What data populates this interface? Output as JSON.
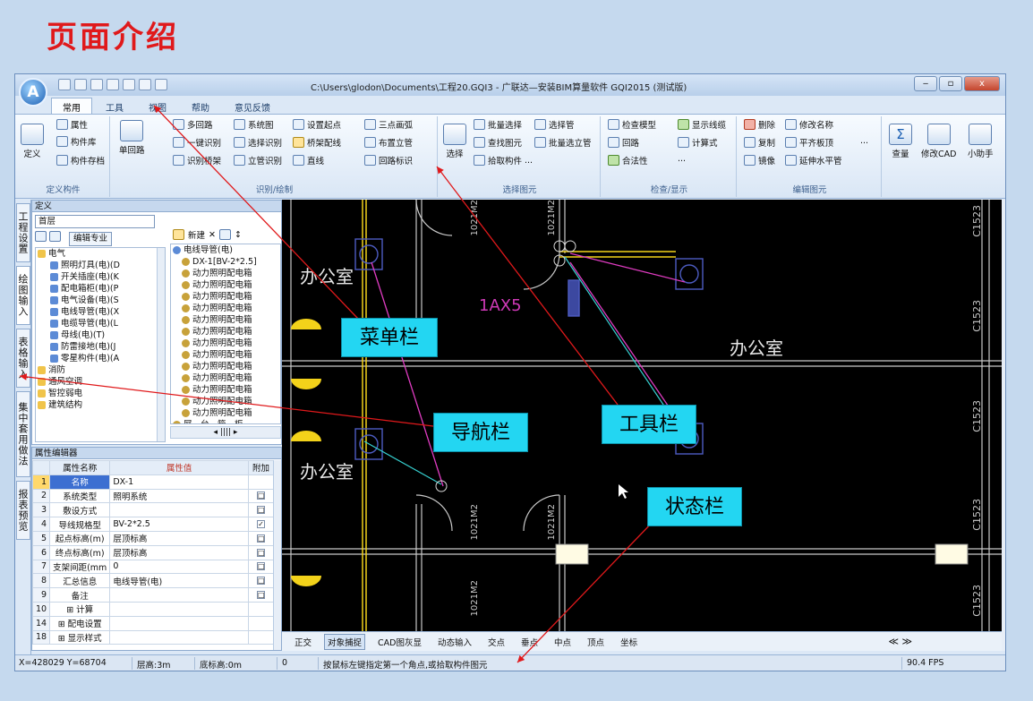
{
  "page_title": "页面介绍",
  "app": {
    "logo": "A",
    "window_title": "C:\\Users\\glodon\\Documents\\工程20.GQI3 - 广联达—安装BIM算量软件 GQI2015 (测试版)",
    "tabs": [
      "常用",
      "工具",
      "视图",
      "帮助",
      "意见反馈"
    ],
    "window_buttons": {
      "minimize": "‒",
      "restore": "▫",
      "close": "x"
    }
  },
  "ribbon": {
    "define": {
      "properties": "属性",
      "library": "构件库",
      "define": "定义",
      "archive": "构件存档",
      "label": "定义构件"
    },
    "recognize": {
      "single_loop": "单回路",
      "multi_loop": "多回路",
      "system_diagram": "系统图",
      "set_start": "设置起点",
      "three_point": "三点画弧",
      "one_key": "一键识别",
      "select_recognize": "选择识别",
      "bridge_wiring": "桥架配线",
      "vertical_pipe": "布置立管",
      "recognize_bridge": "识别桥架",
      "riser_recognize": "立管识别",
      "line": "直线",
      "loop_mark": "回路标识",
      "label": "识别/绘制"
    },
    "select": {
      "select": "选择",
      "batch_select": "批量选择",
      "select_pipe": "选择管",
      "find_element": "查找图元",
      "batch_select_pipe": "批量选立管",
      "pick": "拾取构件",
      "more": "...",
      "label": "选择图元"
    },
    "check": {
      "check_model": "检查模型",
      "show_lines": "显示线缆",
      "loop": "回路",
      "formula": "计算式",
      "legality": "合法性",
      "more": "...",
      "label": "检查/显示"
    },
    "edit": {
      "delete": "删除",
      "rename": "修改名称",
      "copy": "复制",
      "flat_top": "平齐板顶",
      "mirror": "镜像",
      "extend_horizontal": "延伸水平管",
      "more": "...",
      "label": "编辑图元"
    },
    "right": {
      "view_qty": "查量",
      "modify_cad": "修改CAD",
      "assistant": "小助手",
      "sigma": "Σ"
    }
  },
  "left_tabs": [
    "工程设置",
    "绘图输入",
    "表格输入",
    "集中套用做法",
    "报表预览"
  ],
  "nav": {
    "header": "定义",
    "floor": "首层",
    "spec_label": "编辑专业",
    "tree": [
      {
        "label": "电气",
        "level": 0
      },
      {
        "label": "照明灯具(电)(D",
        "level": 1
      },
      {
        "label": "开关插座(电)(K",
        "level": 1
      },
      {
        "label": "配电箱柜(电)(P",
        "level": 1
      },
      {
        "label": "电气设备(电)(S",
        "level": 1
      },
      {
        "label": "电线导管(电)(X",
        "level": 1
      },
      {
        "label": "电缆导管(电)(L",
        "level": 1
      },
      {
        "label": "母线(电)(T)",
        "level": 1
      },
      {
        "label": "防雷接地(电)(J",
        "level": 1
      },
      {
        "label": "零星构件(电)(A",
        "level": 1
      },
      {
        "label": "消防",
        "level": 0
      },
      {
        "label": "通风空调",
        "level": 0
      },
      {
        "label": "智控弱电",
        "level": 0
      },
      {
        "label": "建筑结构",
        "level": 0
      }
    ],
    "toolbar_new": "新建",
    "tree2": [
      "电线导管(电)",
      "DX-1[BV-2*2.5]",
      "动力照明配电箱",
      "动力照明配电箱",
      "动力照明配电箱",
      "动力照明配电箱",
      "动力照明配电箱",
      "动力照明配电箱",
      "动力照明配电箱",
      "动力照明配电箱",
      "动力照明配电箱",
      "动力照明配电箱",
      "动力照明配电箱",
      "动力照明配电箱",
      "动力照明配电箱",
      "屏、台、箱、柜"
    ],
    "hscroll": "◂ |||| ▸"
  },
  "properties": {
    "header": "属性编辑器",
    "columns": [
      "属性名称",
      "属性值",
      "附加"
    ],
    "rows": [
      {
        "n": "1",
        "name": "名称",
        "value": "DX-1",
        "check": ""
      },
      {
        "n": "2",
        "name": "系统类型",
        "value": "照明系统",
        "check": "□"
      },
      {
        "n": "3",
        "name": "敷设方式",
        "value": "",
        "check": "□"
      },
      {
        "n": "4",
        "name": "导线规格型",
        "value": "BV-2*2.5",
        "check": "✓"
      },
      {
        "n": "5",
        "name": "起点标高(m)",
        "value": "层顶标高",
        "check": "□"
      },
      {
        "n": "6",
        "name": "终点标高(m)",
        "value": "层顶标高",
        "check": "□"
      },
      {
        "n": "7",
        "name": "支架间距(mm",
        "value": "0",
        "check": "□"
      },
      {
        "n": "8",
        "name": "汇总信息",
        "value": "电线导管(电)",
        "check": "□"
      },
      {
        "n": "9",
        "name": "备注",
        "value": "",
        "check": "□"
      },
      {
        "n": "10",
        "name": "⊞ 计算",
        "value": "",
        "check": ""
      },
      {
        "n": "14",
        "name": "⊞ 配电设置",
        "value": "",
        "check": ""
      },
      {
        "n": "18",
        "name": "⊞ 显示样式",
        "value": "",
        "check": ""
      }
    ]
  },
  "cad": {
    "rooms": [
      "办公室",
      "办公室",
      "办公室"
    ],
    "door_labels": [
      "1021M2",
      "1021M2",
      "1021M2",
      "1021M2",
      "1021M2"
    ],
    "window_labels": [
      "C1523",
      "C1523",
      "C1523",
      "C1523",
      "C1523",
      "C1523"
    ],
    "box_label": "1AX5"
  },
  "snapbar": {
    "items": [
      "正交",
      "对象捕捉",
      "CAD图灰显",
      "动态输入",
      "交点",
      "垂点",
      "中点",
      "顶点",
      "坐标"
    ],
    "nav": "≪  ≫"
  },
  "statusbar": {
    "coords": "X=428029 Y=68704",
    "floor_height": "层高:3m",
    "base_height": "底标高:0m",
    "zero": "0",
    "hint": "按鼠标左键指定第一个角点,或拾取构件图元",
    "fps": "90.4 FPS"
  },
  "callouts": {
    "menu": "菜单栏",
    "nav": "导航栏",
    "tools": "工具栏",
    "status": "状态栏"
  },
  "colors": {
    "title_red": "#e0191b",
    "callout_cyan": "#23d6f2",
    "arrow_red": "#e0191b",
    "cad_bg": "#000000"
  }
}
